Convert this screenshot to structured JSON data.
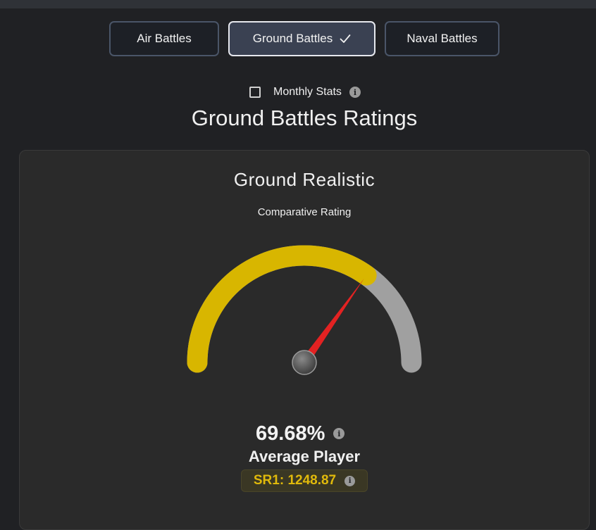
{
  "mode_tabs": [
    {
      "label": "Air Battles",
      "active": false
    },
    {
      "label": "Ground Battles",
      "active": true
    },
    {
      "label": "Naval Battles",
      "active": false
    }
  ],
  "monthly_stats": {
    "label": "Monthly Stats",
    "checked": false
  },
  "page_title": "Ground Battles Ratings",
  "card": {
    "title": "Ground Realistic",
    "subtitle": "Comparative Rating",
    "gauge": {
      "value_percent": 69.68,
      "fill_color": "#d8b600",
      "track_color": "#a0a0a0",
      "needle_color": "#e32222"
    },
    "percent_text": "69.68%",
    "player_label": "Average Player",
    "sr_text": "SR1: 1248.87",
    "sr_color": "#e0b90b"
  },
  "icons": {
    "check": "checkmark-icon",
    "info": "info-icon"
  }
}
